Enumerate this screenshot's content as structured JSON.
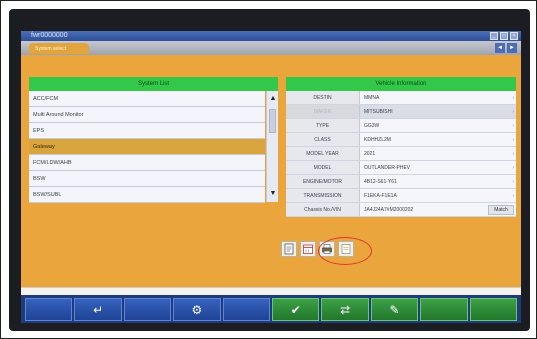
{
  "window": {
    "title": "fwr0000000",
    "tab_label": "System select",
    "nav_prev": "◄",
    "nav_next": "►"
  },
  "system_list": {
    "header": "System List",
    "items": [
      {
        "label": "ACC/FCM",
        "selected": false
      },
      {
        "label": "Multi Around Monitor",
        "selected": false
      },
      {
        "label": "EPS",
        "selected": false
      },
      {
        "label": "Gateway",
        "selected": true
      },
      {
        "label": "FCM/LDW/AHB",
        "selected": false
      },
      {
        "label": "BSW",
        "selected": false
      },
      {
        "label": "BSW/SUBL",
        "selected": false
      }
    ],
    "scroll_up_icon": "triangle-up-icon",
    "scroll_down_icon": "triangle-down-icon"
  },
  "vehicle_info": {
    "header": "Vehicle Information",
    "rows": [
      {
        "label": "DESTIN",
        "value": "MMNA",
        "dim": false
      },
      {
        "label": "MAKER",
        "value": "MITSUBISHI",
        "dim": true
      },
      {
        "label": "TYPE",
        "value": "GG3W",
        "dim": false
      },
      {
        "label": "CLASS",
        "value": "KDHHZL2M",
        "dim": false
      },
      {
        "label": "MODEL YEAR",
        "value": "2021",
        "dim": false
      },
      {
        "label": "MODEL",
        "value": "OUTLANDER-PHEV",
        "dim": false
      },
      {
        "label": "ENGINE/MOTOR",
        "value": "4B12-S61-Y61",
        "dim": false
      },
      {
        "label": "TRANSMISSION",
        "value": "F1EKA-F1E1A",
        "dim": false
      },
      {
        "label": "Chassis No./VIN",
        "value": "JA4J24A7#M2000202",
        "dim": false
      }
    ],
    "match_label": "Match"
  },
  "toolbar_icons": [
    "document-icon",
    "calendar-icon",
    "printer-icon",
    "note-icon"
  ],
  "bottom_bar": [
    {
      "name": "blank-button-1",
      "glyph": "",
      "color": "blue"
    },
    {
      "name": "return-button",
      "glyph": "↵",
      "color": "blue"
    },
    {
      "name": "blank-button-2",
      "glyph": "",
      "color": "blue"
    },
    {
      "name": "tool-button",
      "glyph": "⚙",
      "color": "blue"
    },
    {
      "name": "blank-button-3",
      "glyph": "",
      "color": "blue"
    },
    {
      "name": "ok-button",
      "glyph": "✔",
      "color": "green"
    },
    {
      "name": "cycle-button",
      "glyph": "⇄",
      "color": "green"
    },
    {
      "name": "erase-button",
      "glyph": "✎",
      "color": "green"
    },
    {
      "name": "blank-button-4",
      "glyph": "",
      "color": "green"
    },
    {
      "name": "blank-button-5",
      "glyph": "",
      "color": "green"
    }
  ],
  "colors": {
    "screen_bg": "#eaa63d",
    "header_green": "#33c84a",
    "selected_row": "#d7a43e",
    "annotation": "#e2352f"
  }
}
